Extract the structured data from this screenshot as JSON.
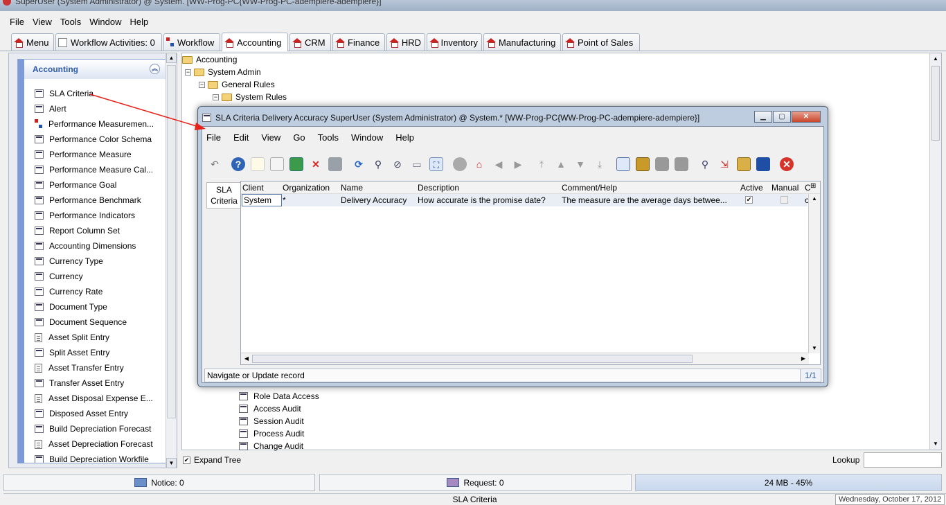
{
  "os_window": {
    "title": "SuperUser (System Administrator) @ System.  [WW-Prog-PC{WW-Prog-PC-adempiere-adempiere}]"
  },
  "menubar": [
    "File",
    "View",
    "Tools",
    "Window",
    "Help"
  ],
  "tabs": [
    {
      "label": "Menu",
      "icon": "home-icon"
    },
    {
      "label": "Workflow Activities: 0",
      "icon": "workflow-activities-icon"
    },
    {
      "label": "Workflow",
      "icon": "workflow-icon"
    },
    {
      "label": "Accounting",
      "icon": "home-icon",
      "active": true
    },
    {
      "label": "CRM",
      "icon": "home-icon"
    },
    {
      "label": "Finance",
      "icon": "home-icon"
    },
    {
      "label": "HRD",
      "icon": "home-icon"
    },
    {
      "label": "Inventory",
      "icon": "home-icon"
    },
    {
      "label": "Manufacturing",
      "icon": "home-icon"
    },
    {
      "label": "Point of Sales",
      "icon": "home-icon"
    }
  ],
  "left_panel": {
    "title": "Accounting",
    "items": [
      {
        "label": "SLA Criteria",
        "icon": "window-icon"
      },
      {
        "label": "Alert",
        "icon": "window-icon"
      },
      {
        "label": "Performance Measuremen...",
        "icon": "workflow-icon"
      },
      {
        "label": "Performance Color Schema",
        "icon": "window-icon"
      },
      {
        "label": "Performance Measure",
        "icon": "window-icon"
      },
      {
        "label": "Performance Measure Cal...",
        "icon": "window-icon"
      },
      {
        "label": "Performance Goal",
        "icon": "window-icon"
      },
      {
        "label": "Performance Benchmark",
        "icon": "window-icon"
      },
      {
        "label": "Performance Indicators",
        "icon": "window-icon"
      },
      {
        "label": "Report Column Set",
        "icon": "window-icon"
      },
      {
        "label": "Accounting Dimensions",
        "icon": "window-icon"
      },
      {
        "label": "Currency Type",
        "icon": "window-icon"
      },
      {
        "label": "Currency",
        "icon": "window-icon"
      },
      {
        "label": "Currency Rate",
        "icon": "window-icon"
      },
      {
        "label": "Document Type",
        "icon": "window-icon"
      },
      {
        "label": "Document Sequence",
        "icon": "window-icon"
      },
      {
        "label": "Asset Split Entry",
        "icon": "document-icon"
      },
      {
        "label": "Split Asset Entry",
        "icon": "window-icon"
      },
      {
        "label": "Asset Transfer Entry",
        "icon": "document-icon"
      },
      {
        "label": "Transfer Asset Entry",
        "icon": "window-icon"
      },
      {
        "label": "Asset Disposal Expense E...",
        "icon": "document-icon"
      },
      {
        "label": "Disposed Asset Entry",
        "icon": "window-icon"
      },
      {
        "label": "Build Depreciation Forecast",
        "icon": "window-icon"
      },
      {
        "label": "Asset Depreciation Forecast",
        "icon": "document-icon"
      },
      {
        "label": "Build Depreciation Workfile",
        "icon": "window-icon"
      }
    ]
  },
  "tree": {
    "top": [
      {
        "label": "Accounting",
        "level": 0
      },
      {
        "label": "System Admin",
        "level": 1
      },
      {
        "label": "General Rules",
        "level": 2
      },
      {
        "label": "System Rules",
        "level": 3
      }
    ],
    "bottom": [
      {
        "label": "Role Data Access"
      },
      {
        "label": "Access Audit"
      },
      {
        "label": "Session Audit"
      },
      {
        "label": "Process Audit"
      },
      {
        "label": "Change Audit"
      }
    ],
    "expand_tree_label": "Expand Tree",
    "expand_tree_checked": true,
    "lookup_label": "Lookup",
    "lookup_value": ""
  },
  "status": {
    "notice": "Notice: 0",
    "request": "Request: 0",
    "memory": "24 MB - 45%",
    "window_name": "SLA Criteria",
    "date": "Wednesday, October 17, 2012"
  },
  "modal": {
    "title": "SLA Criteria  Delivery Accuracy  SuperUser (System Administrator) @ System.* [WW-Prog-PC{WW-Prog-PC-adempiere-adempiere}]",
    "menu": [
      "File",
      "Edit",
      "View",
      "Go",
      "Tools",
      "Window",
      "Help"
    ],
    "side_tab": [
      "SLA",
      "Criteria"
    ],
    "columns": [
      "Client",
      "Organization",
      "Name",
      "Description",
      "Comment/Help",
      "Active",
      "Manual",
      "C"
    ],
    "row": {
      "client": "System",
      "organization": "*",
      "name": "Delivery Accuracy",
      "description": "How accurate is the promise date?",
      "comment": "The measure are the average days betwee...",
      "active": true,
      "manual": false,
      "c": "o"
    },
    "status_text": "Navigate or Update record",
    "record_count": "1/1",
    "toolbar_icons": [
      "undo-icon",
      "help-icon",
      "new-record-icon",
      "copy-record-icon",
      "save-new-icon",
      "delete-icon",
      "save-icon",
      "refresh-icon",
      "find-icon",
      "attachment-icon",
      "chat-icon",
      "grid-toggle-icon",
      "history-icon",
      "home-icon",
      "previous-record-icon",
      "next-record-icon",
      "first-record-icon",
      "previous-icon",
      "next-icon",
      "last-record-icon",
      "report-icon",
      "archive-icon",
      "print-preview-icon",
      "print-icon",
      "zoom-across-icon",
      "workflow-icon",
      "product-info-icon",
      "process-icon",
      "exit-icon"
    ]
  }
}
